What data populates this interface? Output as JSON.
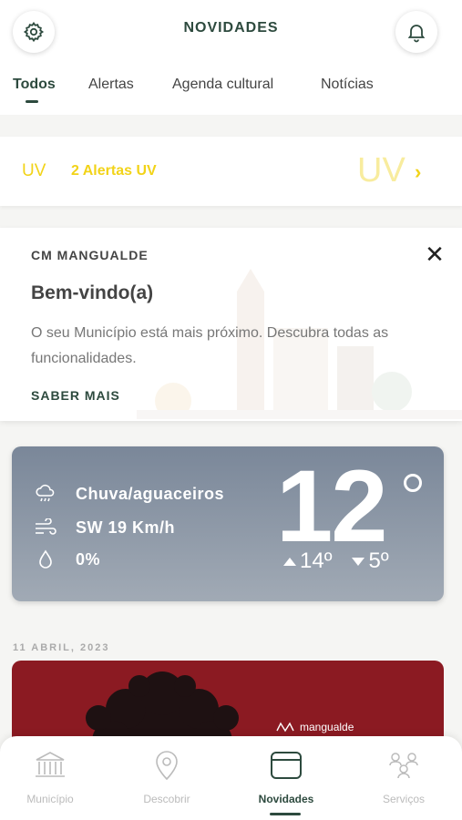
{
  "header": {
    "title": "NOVIDADES",
    "settings_icon": "gear-icon",
    "notifications_icon": "bell-icon"
  },
  "tabs": [
    {
      "label": "Todos",
      "active": true
    },
    {
      "label": "Alertas",
      "active": false
    },
    {
      "label": "Agenda cultural",
      "active": false
    },
    {
      "label": "Notícias",
      "active": false
    }
  ],
  "uv_alert": {
    "badge": "UV",
    "text": "2 Alertas UV",
    "watermark": "UV",
    "chevron": "›",
    "color": "#f2d318"
  },
  "welcome": {
    "organization": "CM MANGUALDE",
    "title": "Bem-vindo(a)",
    "body": "O seu Município está mais próximo. Descubra todas as funcionalidades.",
    "link": "SABER MAIS",
    "close": "✕"
  },
  "weather": {
    "condition": "Chuva/aguaceiros",
    "wind": "SW 19 Km/h",
    "precipitation": "0%",
    "temperature": "12",
    "high": "14º",
    "low": "5º"
  },
  "news": {
    "date": "11 ABRIL, 2023",
    "logo_text": "mangualde",
    "color": "#8b1a22"
  },
  "bottom_nav": [
    {
      "label": "Município",
      "icon": "building-icon",
      "active": false
    },
    {
      "label": "Descobrir",
      "icon": "location-pin-icon",
      "active": false
    },
    {
      "label": "Novidades",
      "icon": "news-card-icon",
      "active": true
    },
    {
      "label": "Serviços",
      "icon": "services-icon",
      "active": false
    }
  ],
  "colors": {
    "accent": "#2d4a3e",
    "uv": "#f2d318",
    "weather_card": "#7a8799"
  }
}
